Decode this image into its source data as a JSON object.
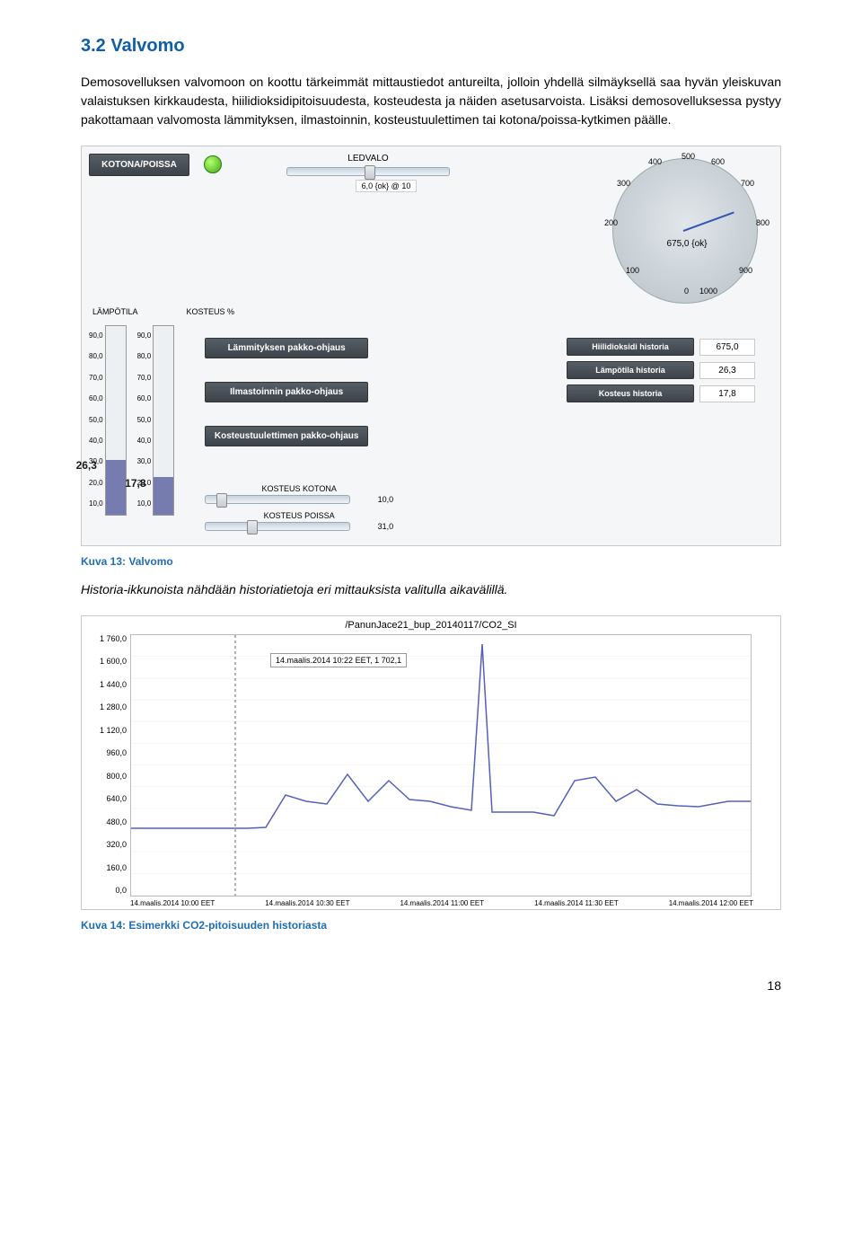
{
  "section": {
    "heading": "3.2 Valvomo",
    "para1": "Demosovelluksen valvomoon on koottu tärkeimmät mittaustiedot antureilta, jolloin yhdellä silmäyksellä saa hyvän yleiskuvan valaistuksen kirkkaudesta, hiilidioksidipitoisuudesta, kosteudesta ja näiden asetusarvoista. Lisäksi demosovelluksessa pystyy pakottamaan valvomosta lämmityksen, ilmastoinnin, kosteustuulettimen tai kotona/poissa-kytkimen päälle.",
    "fig1_caption": "Kuva 13: Valvomo",
    "para2": "Historia-ikkunoista nähdään historiatietoja eri mittauksista valitulla aikavälillä.",
    "fig2_caption": "Kuva 14: Esimerkki CO2-pitoisuuden historiasta",
    "pagenum": "18"
  },
  "valvomo": {
    "kotona_poissa": "KOTONA/POISSA",
    "led_label": "LEDVALO",
    "led_readout": "6,0 {ok} @ 10",
    "gauge": {
      "ticks": [
        "0",
        "100",
        "200",
        "300",
        "400",
        "500",
        "600",
        "700",
        "800",
        "900",
        "1000"
      ],
      "value": "675,0 {ok}"
    },
    "lampotila_label": "LÄMPÖTILA",
    "kosteus_label": "KOSTEUS %",
    "scale": [
      "90,0",
      "80,0",
      "70,0",
      "60,0",
      "50,0",
      "40,0",
      "30,0",
      "20,0",
      "10,0"
    ],
    "temp_val": "26,3",
    "kosteus_val": "17,8",
    "pakko": [
      "Lämmityksen pakko-ohjaus",
      "Ilmastoinnin pakko-ohjaus",
      "Kosteustuulettimen pakko-ohjaus"
    ],
    "kosteus_kotona_label": "KOSTEUS KOTONA",
    "kosteus_kotona_val": "10,0",
    "kosteus_poissa_label": "KOSTEUS POISSA",
    "kosteus_poissa_val": "31,0",
    "hist": [
      {
        "label": "Hiilidioksidi historia",
        "val": "675,0"
      },
      {
        "label": "Lämpötila historia",
        "val": "26,3"
      },
      {
        "label": "Kosteus historia",
        "val": "17,8"
      }
    ]
  },
  "co2": {
    "title": "/PanunJace21_bup_20140117/CO2_SI",
    "tooltip": "14.maalis.2014 10:22 EET, 1 702,1",
    "yticks": [
      "1 760,0",
      "1 600,0",
      "1 440,0",
      "1 280,0",
      "1 120,0",
      "960,0",
      "800,0",
      "640,0",
      "480,0",
      "320,0",
      "160,0",
      "0,0"
    ],
    "xticks": [
      "14.maalis.2014 10:00 EET",
      "14.maalis.2014 10:30 EET",
      "14.maalis.2014 11:00 EET",
      "14.maalis.2014 11:30 EET",
      "14.maalis.2014 12:00 EET"
    ]
  },
  "chart_data": {
    "type": "line",
    "title": "/PanunJace21_bup_20140117/CO2_SI",
    "xlabel": "",
    "ylabel": "",
    "ylim": [
      0,
      1760
    ],
    "x": [
      "10:00",
      "10:05",
      "10:10",
      "10:14",
      "10:18",
      "10:22",
      "10:26",
      "10:30",
      "10:34",
      "10:38",
      "10:42",
      "10:46",
      "10:50",
      "10:54",
      "10:58",
      "11:02",
      "11:06",
      "11:08",
      "11:10",
      "11:14",
      "11:18",
      "11:22",
      "11:26",
      "11:30",
      "11:34",
      "11:38",
      "11:42",
      "11:46",
      "11:50",
      "11:56",
      "12:00"
    ],
    "values": [
      455,
      455,
      455,
      455,
      455,
      455,
      460,
      680,
      640,
      620,
      820,
      640,
      780,
      650,
      640,
      600,
      580,
      1702,
      560,
      560,
      560,
      540,
      780,
      800,
      640,
      720,
      620,
      610,
      600,
      640,
      640
    ],
    "annotation": {
      "x": "10:22",
      "y": 1702.1,
      "text": "14.maalis.2014 10:22 EET, 1 702,1"
    }
  }
}
